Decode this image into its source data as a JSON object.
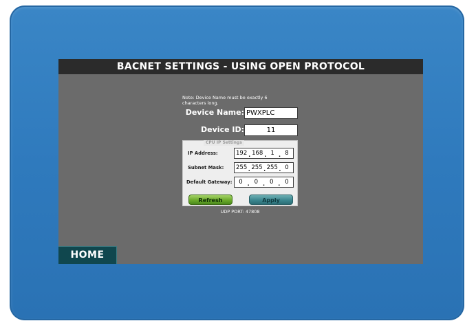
{
  "header": {
    "title": "BACNET SETTINGS - USING OPEN PROTOCOL"
  },
  "note": "Note: Device Name must be exactly 6 characters long.",
  "device": {
    "name_label": "Device Name:",
    "name_value": "PWXPLC",
    "id_label": "Device ID:",
    "id_value": "11"
  },
  "cpu_ip_settings": {
    "legend": "CPU IP Settings",
    "ip_address": {
      "label": "IP Address:",
      "octets": [
        "192",
        "168",
        "1",
        "8"
      ]
    },
    "subnet_mask": {
      "label": "Subnet Mask:",
      "octets": [
        "255",
        "255",
        "255",
        "0"
      ]
    },
    "default_gateway": {
      "label": "Default Gateway:",
      "octets": [
        "0",
        "0",
        "0",
        "0"
      ]
    },
    "separator": ".",
    "refresh_label": "Refresh",
    "apply_label": "Apply"
  },
  "udp_port": "UDP PORT: 47808",
  "nav": {
    "home_label": "HOME"
  },
  "colors": {
    "bezel": "#2f7abd",
    "screen": "#6b6b6b",
    "title_bar": "#2b2b2b",
    "refresh_button": "#6cab2c",
    "apply_button": "#3c8790",
    "home_button": "#10474e"
  }
}
